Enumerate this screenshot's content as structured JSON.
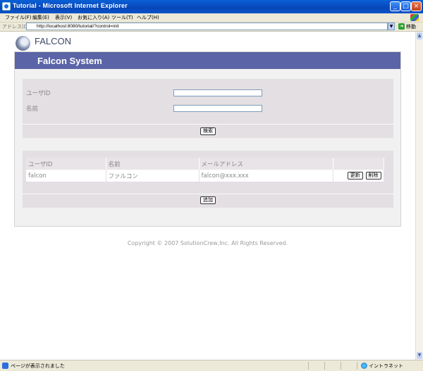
{
  "window": {
    "title": "Tutorial - Microsoft Internet Explorer"
  },
  "menu": {
    "items": [
      "ファイル(F)",
      "編集(E)",
      "表示(V)",
      "お気に入り(A)",
      "ツール(T)",
      "ヘルプ(H)"
    ]
  },
  "address": {
    "label": "アドレス(D)",
    "url": "http://localhost:8080/tutorial/?control=init",
    "go": "移動"
  },
  "brand": {
    "logo_text": "FALCON"
  },
  "header": {
    "title": "Falcon System"
  },
  "search": {
    "user_id_label": "ユーザID",
    "user_id_value": "",
    "name_label": "名前",
    "name_value": "",
    "button": "検索"
  },
  "table": {
    "columns": [
      "ユーザID",
      "名前",
      "メールアドレス",
      ""
    ],
    "rows": [
      {
        "user_id": "falcon",
        "name": "ファルコン",
        "email": "falcon@xxx.xxx",
        "update": "更新",
        "delete": "削除"
      }
    ],
    "add_button": "追加"
  },
  "footer": {
    "copyright": "Copyright © 2007 SolutionCrew,Inc. All Rights Reserved."
  },
  "status": {
    "text": "ページが表示されました",
    "zone": "イントラネット"
  }
}
